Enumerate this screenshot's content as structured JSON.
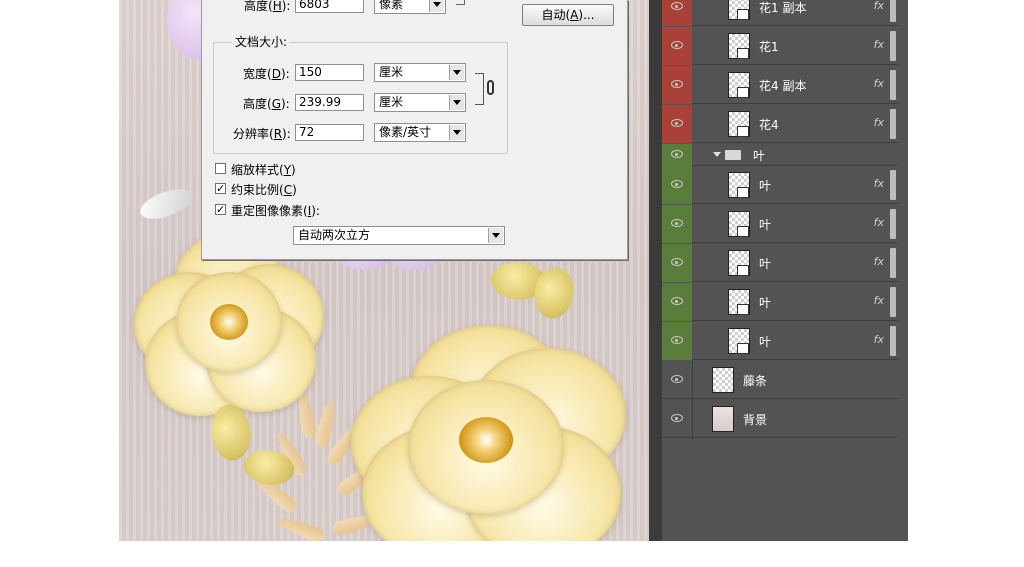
{
  "dialog": {
    "top_row": {
      "label_pre": "高度(",
      "label_key": "H",
      "label_post": "):",
      "value": "6803",
      "unit": "像素"
    },
    "auto_button": {
      "pre": "自动(",
      "key": "A",
      "post": ")..."
    },
    "doc_size_title": "文档大小:",
    "width": {
      "label_pre": "宽度(",
      "label_key": "D",
      "label_post": "):",
      "value": "150",
      "unit": "厘米"
    },
    "height": {
      "label_pre": "高度(",
      "label_key": "G",
      "label_post": "):",
      "value": "239.99",
      "unit": "厘米"
    },
    "resolution": {
      "label_pre": "分辨率(",
      "label_key": "R",
      "label_post": "):",
      "value": "72",
      "unit": "像素/英寸"
    },
    "options": [
      {
        "label_pre": "缩放样式(",
        "key": "Y",
        "label_post": ")",
        "checked": false
      },
      {
        "label_pre": "约束比例(",
        "key": "C",
        "label_post": ")",
        "checked": true
      },
      {
        "label_pre": "重定图像像素(",
        "key": "I",
        "label_post": "):",
        "checked": true
      }
    ],
    "resample_method": "自动两次立方"
  },
  "layers": [
    {
      "name": "花1 副本",
      "color": "red",
      "fx": "fx"
    },
    {
      "name": "花1",
      "color": "red",
      "fx": "fx"
    },
    {
      "name": "花4 副本",
      "color": "red",
      "fx": "fx"
    },
    {
      "name": "花4",
      "color": "red",
      "fx": "fx"
    },
    {
      "name": "叶",
      "color": "green",
      "group": true
    },
    {
      "name": "叶",
      "color": "green",
      "fx": "fx"
    },
    {
      "name": "叶",
      "color": "green",
      "fx": "fx"
    },
    {
      "name": "叶",
      "color": "green",
      "fx": "fx"
    },
    {
      "name": "叶",
      "color": "green",
      "fx": "fx"
    },
    {
      "name": "叶",
      "color": "green",
      "fx": "fx"
    },
    {
      "name": "藤条",
      "color": "none"
    },
    {
      "name": "背景",
      "color": "none"
    }
  ],
  "colors": {
    "red_label": "#a94139",
    "green_label": "#5b7d3c",
    "panel_bg": "#535353"
  }
}
